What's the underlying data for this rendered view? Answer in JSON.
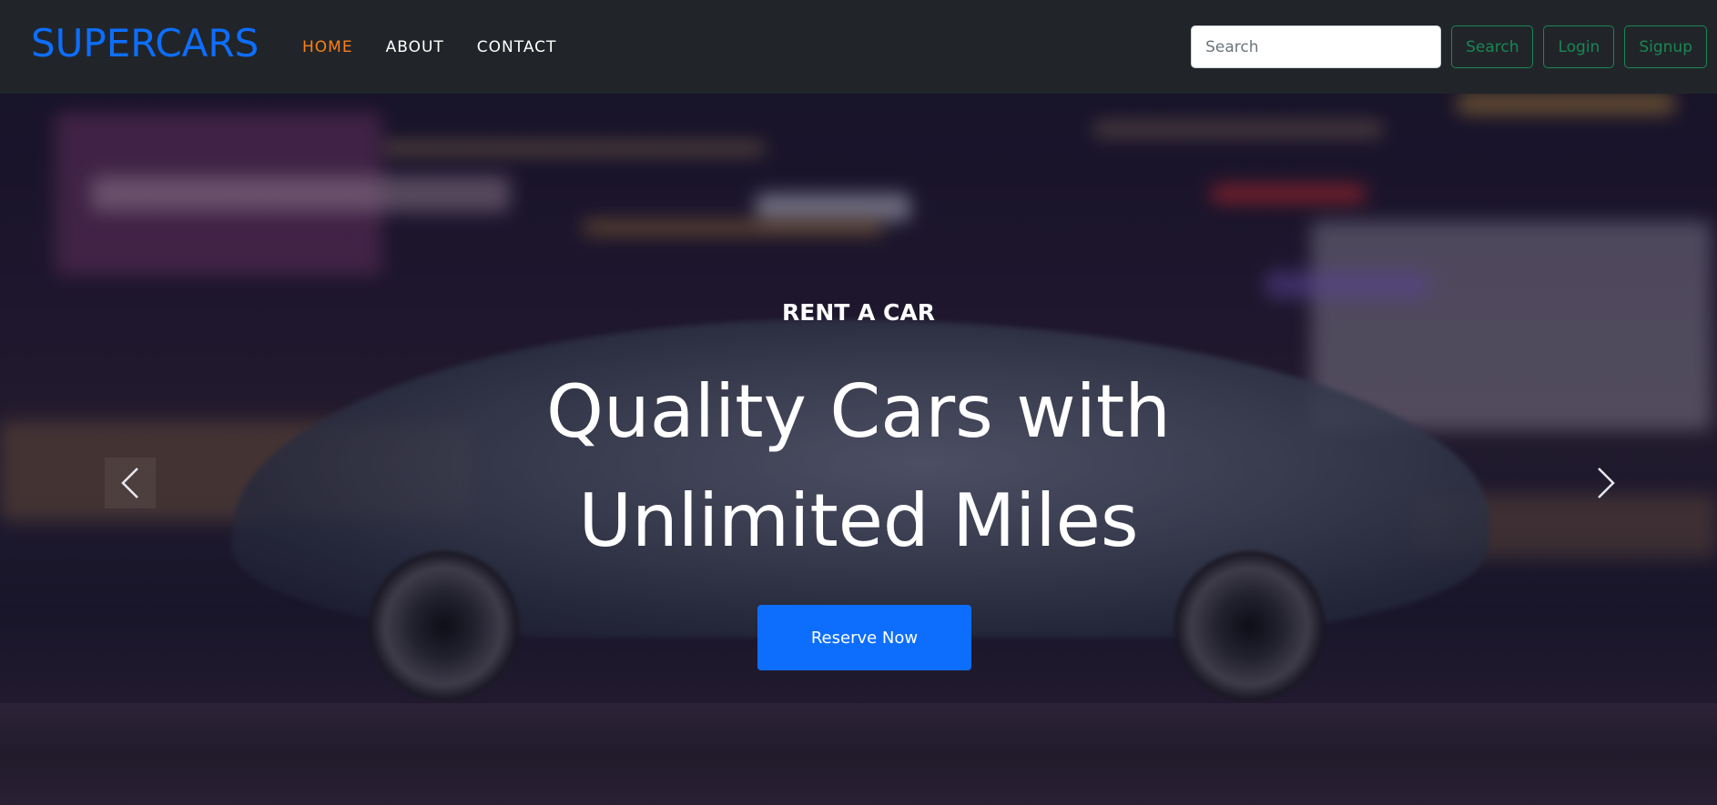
{
  "navbar": {
    "brand": "SUPERCARS",
    "links": [
      {
        "label": "HOME",
        "active": true
      },
      {
        "label": "ABOUT",
        "active": false
      },
      {
        "label": "CONTACT",
        "active": false
      }
    ],
    "search_placeholder": "Search",
    "search_value": "",
    "search_button": "Search",
    "login_button": "Login",
    "signup_button": "Signup"
  },
  "hero": {
    "kicker": "RENT A CAR",
    "headline": "Quality Cars with Unlimited Miles",
    "cta_label": "Reserve Now",
    "prev_icon": "chevron-left-icon",
    "next_icon": "chevron-right-icon"
  },
  "colors": {
    "brand": "#0d6efd",
    "active_link": "#fd7e14",
    "outline_success": "#198754",
    "navbar_bg": "#212529",
    "cta_bg": "#0d6efd"
  }
}
